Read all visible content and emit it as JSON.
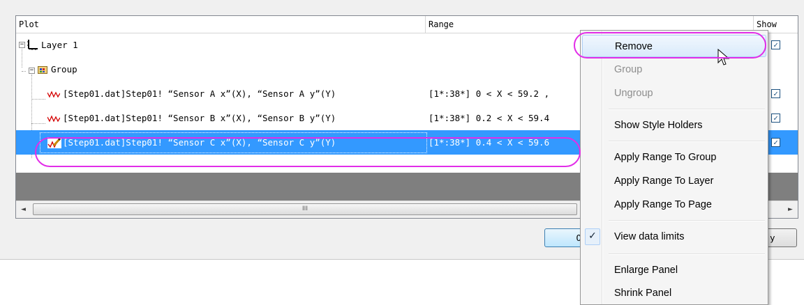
{
  "table": {
    "headers": {
      "plot": "Plot",
      "range": "Range",
      "show": "Show"
    },
    "layer_label": "Layer 1",
    "group_label": "Group",
    "rows": [
      {
        "plot": "[Step01.dat]Step01! “Sensor A x”(X), “Sensor A y”(Y)",
        "range": "[1*:38*]  0 < X < 59.2 ,"
      },
      {
        "plot": "[Step01.dat]Step01! “Sensor B x”(X), “Sensor B y”(Y)",
        "range": "[1*:38*]  0.2 < X < 59.4"
      },
      {
        "plot": "[Step01.dat]Step01! “Sensor C x”(X), “Sensor C y”(Y)",
        "range": "[1*:38*]  0.4 < X < 59.6"
      }
    ],
    "scroll_thumb_glyph": "III"
  },
  "buttons": {
    "ok": "O",
    "apply": "y"
  },
  "context_menu": {
    "items": [
      "Remove",
      "Group",
      "Ungroup",
      "Show Style Holders",
      "Apply Range To Group",
      "Apply Range To Layer",
      "Apply Range To Page",
      "View data limits",
      "Enlarge Panel",
      "Shrink Panel"
    ]
  },
  "colors": {
    "selection": "#3399ff",
    "highlight": "#e22de8",
    "plot_icon": "#d40000"
  },
  "icons": {
    "check": "✓",
    "expander": "−",
    "scroll_left": "◄",
    "scroll_right": "►"
  }
}
